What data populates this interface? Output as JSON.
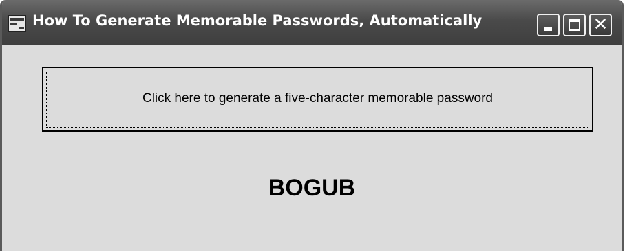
{
  "window": {
    "title": "How To Generate Memorable Passwords, Automatically",
    "controls": {
      "minimize_icon": "minimize-icon",
      "maximize_icon": "maximize-icon",
      "close_icon": "close-icon",
      "close_glyph": "✕"
    }
  },
  "main": {
    "generate_button_label": "Click here to generate a five-character memorable password",
    "password_value": "BOGUB"
  }
}
